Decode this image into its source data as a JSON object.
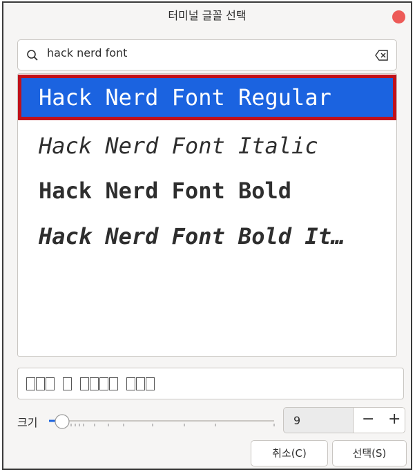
{
  "window": {
    "title": "터미널 글꼴 선택"
  },
  "search": {
    "query": "hack nerd font"
  },
  "fonts": [
    {
      "label": "Hack Nerd Font Regular",
      "selected": true
    },
    {
      "label": "Hack Nerd Font Italic",
      "selected": false
    },
    {
      "label": "Hack Nerd Font Bold",
      "selected": false
    },
    {
      "label": "Hack Nerd Font Bold It…",
      "selected": false
    }
  ],
  "size": {
    "label": "크기",
    "value": "9",
    "minus": "−",
    "plus": "+"
  },
  "buttons": {
    "cancel": "취소(C)",
    "select": "선택(S)"
  },
  "colors": {
    "accent": "#1b63e0",
    "highlight_border": "#c0111a",
    "close": "#ed5a57"
  }
}
